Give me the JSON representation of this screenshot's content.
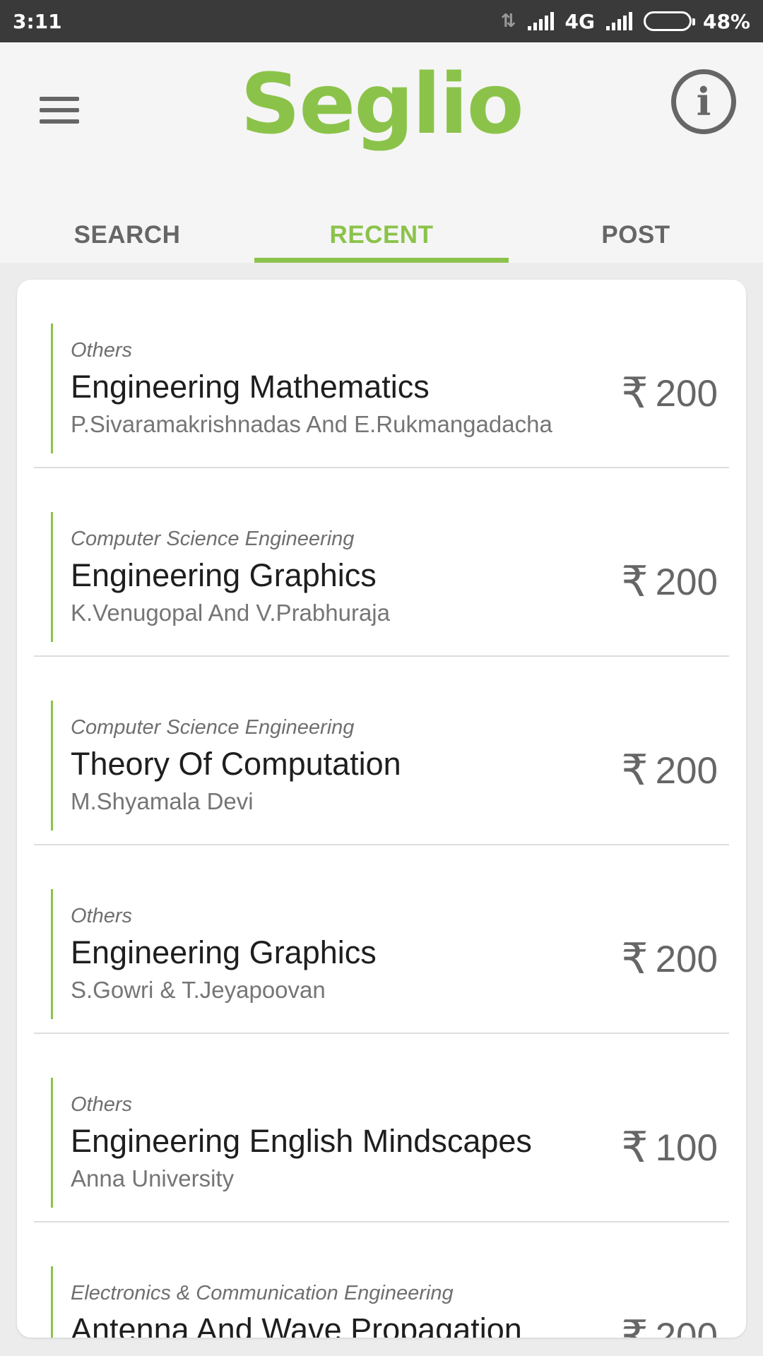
{
  "status_bar": {
    "time": "3:11",
    "network": "4G",
    "battery": "48%",
    "battery_level": 0.48
  },
  "app": {
    "logo": "Seglio",
    "brand_color": "#8bc34a",
    "menu_icon": "hamburger-menu-icon",
    "info_icon": "info-icon"
  },
  "tabs": [
    {
      "label": "SEARCH",
      "active": false
    },
    {
      "label": "RECENT",
      "active": true
    },
    {
      "label": "POST",
      "active": false
    }
  ],
  "currency_symbol": "₹",
  "books": [
    {
      "category": "Others",
      "title": "Engineering Mathematics",
      "author": "P.Sivaramakrishnadas And E.Rukmangadacha",
      "price": "200"
    },
    {
      "category": "Computer Science Engineering",
      "title": "Engineering Graphics",
      "author": "K.Venugopal And V.Prabhuraja",
      "price": "200"
    },
    {
      "category": "Computer Science Engineering",
      "title": "Theory Of Computation",
      "author": "M.Shyamala Devi",
      "price": "200"
    },
    {
      "category": "Others",
      "title": "Engineering Graphics",
      "author": "S.Gowri & T.Jeyapoovan",
      "price": "200"
    },
    {
      "category": "Others",
      "title": "Engineering English Mindscapes",
      "author": "Anna University",
      "price": "100"
    },
    {
      "category": "Electronics & Communication Engineering",
      "title": "Antenna And Wave Propagation",
      "author": "",
      "price": "200"
    }
  ]
}
